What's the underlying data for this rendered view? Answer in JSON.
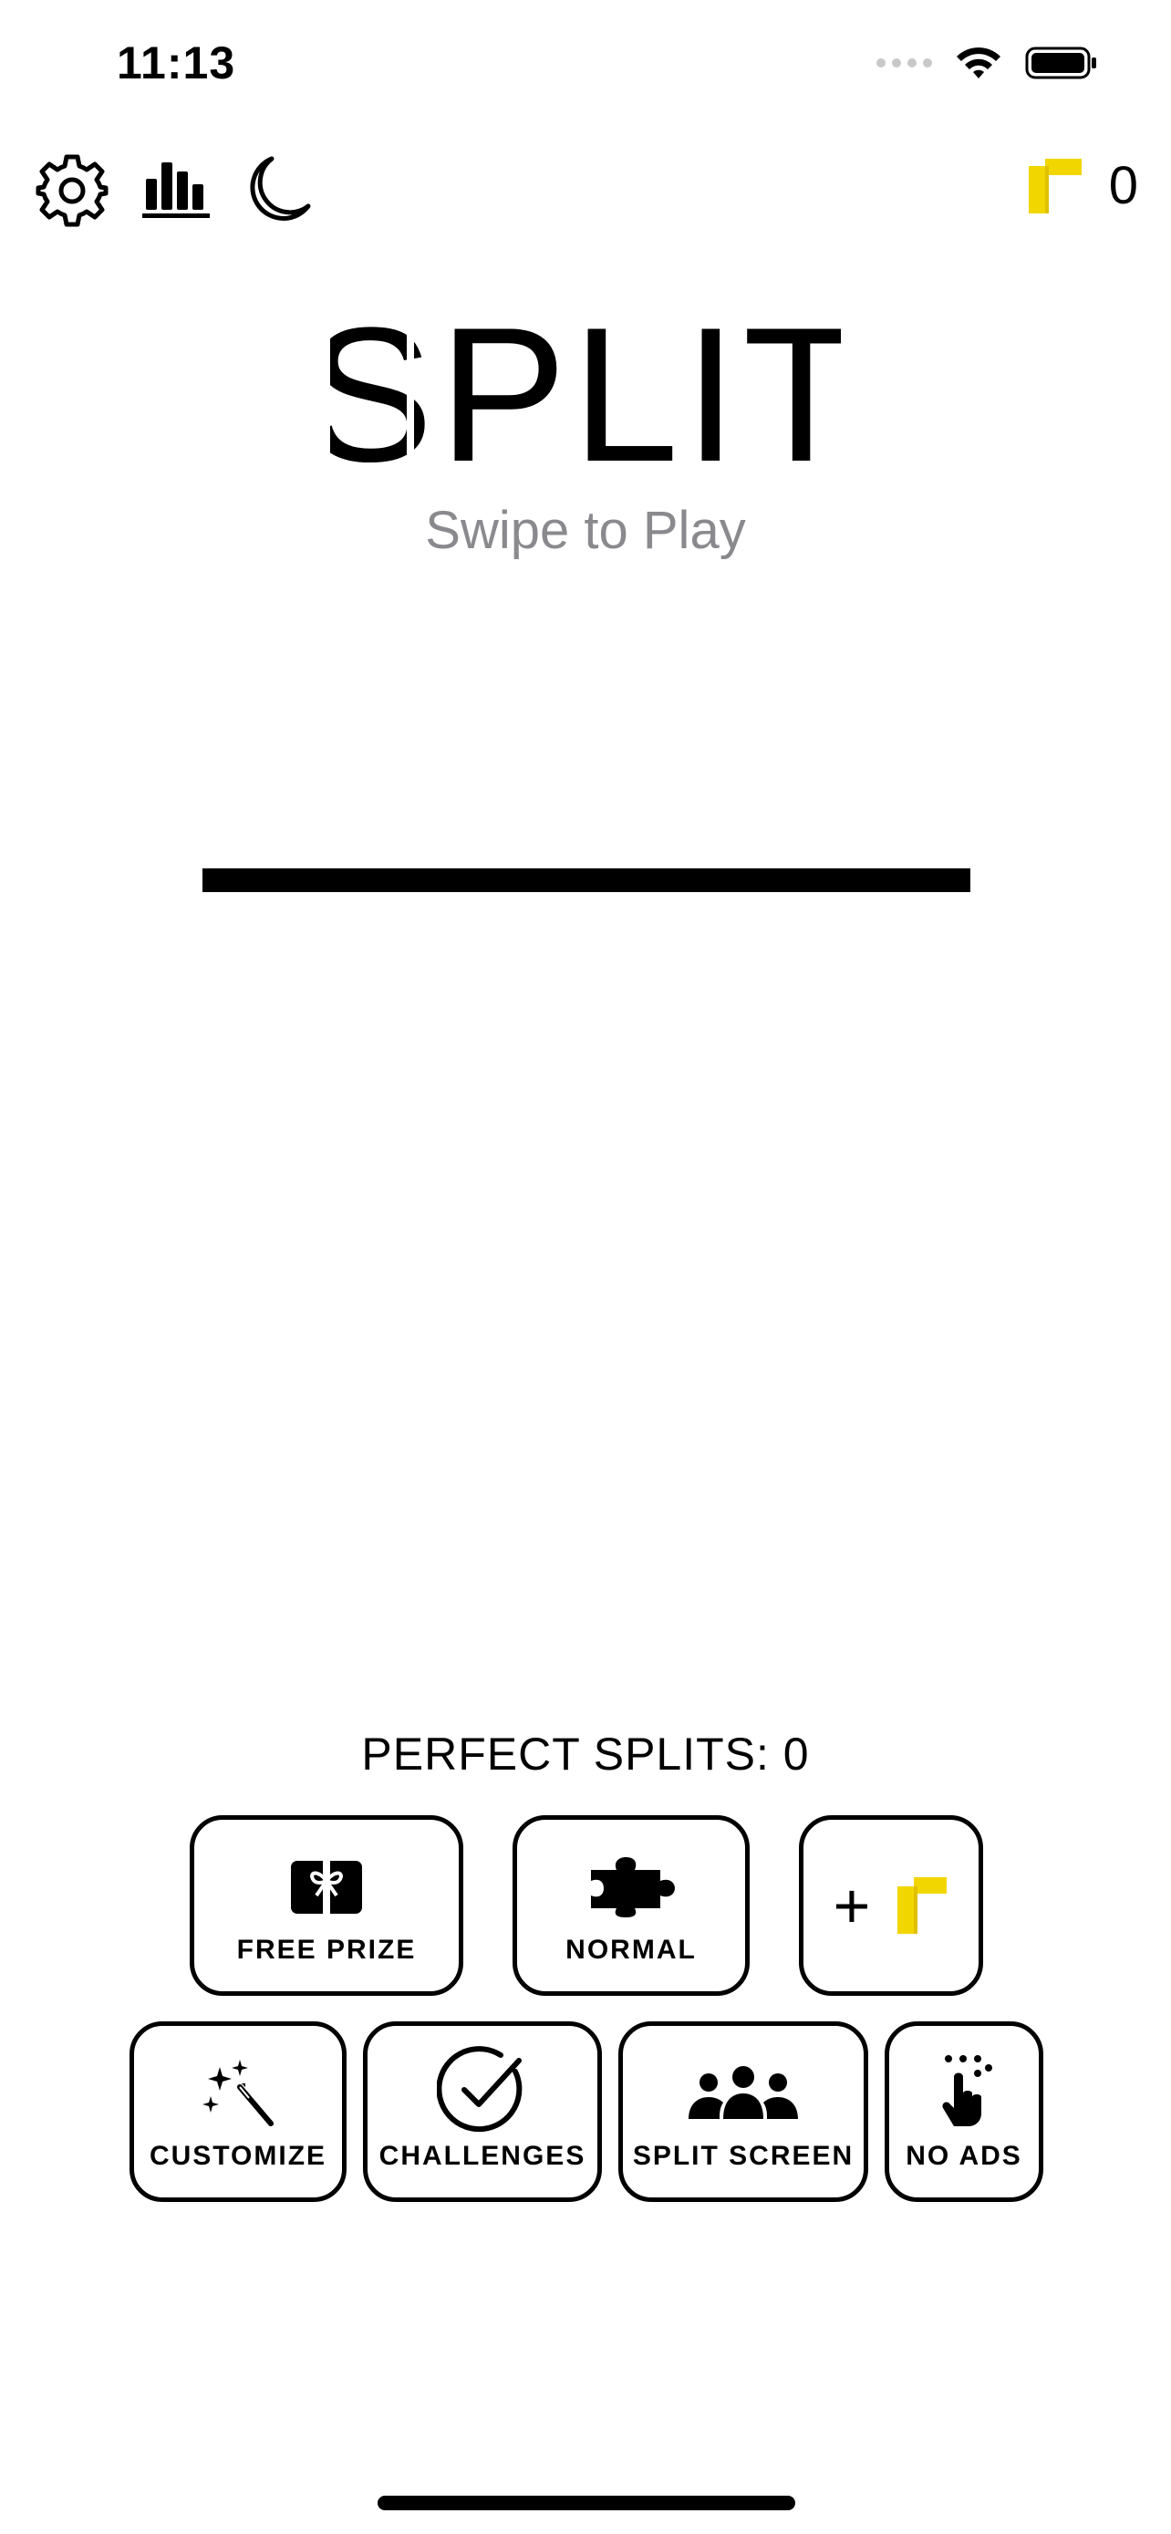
{
  "status_bar": {
    "time": "11:13",
    "icons": [
      "cellular-signal-icon",
      "wifi-icon",
      "battery-icon"
    ]
  },
  "toolbar": {
    "icons": [
      "gear-icon",
      "bar-chart-icon",
      "moon-icon"
    ],
    "coin_count": "0",
    "coin_color": "#F2D600"
  },
  "title": {
    "text": "SPLIT",
    "subtitle": "Swipe to Play"
  },
  "game": {
    "perfect_splits_label": "PERFECT SPLITS: 0"
  },
  "menu": {
    "row1": [
      {
        "label": "FREE PRIZE",
        "icon": "gift-card-icon"
      },
      {
        "label": "NORMAL",
        "icon": "puzzle-piece-icon"
      },
      {
        "label": "+",
        "icon": "coin-icon"
      }
    ],
    "row2": [
      {
        "label": "CUSTOMIZE",
        "icon": "magic-wand-icon"
      },
      {
        "label": "CHALLENGES",
        "icon": "check-circle-icon"
      },
      {
        "label": "SPLIT SCREEN",
        "icon": "people-group-icon"
      },
      {
        "label": "NO ADS",
        "icon": "hand-pointer-icon"
      }
    ]
  }
}
